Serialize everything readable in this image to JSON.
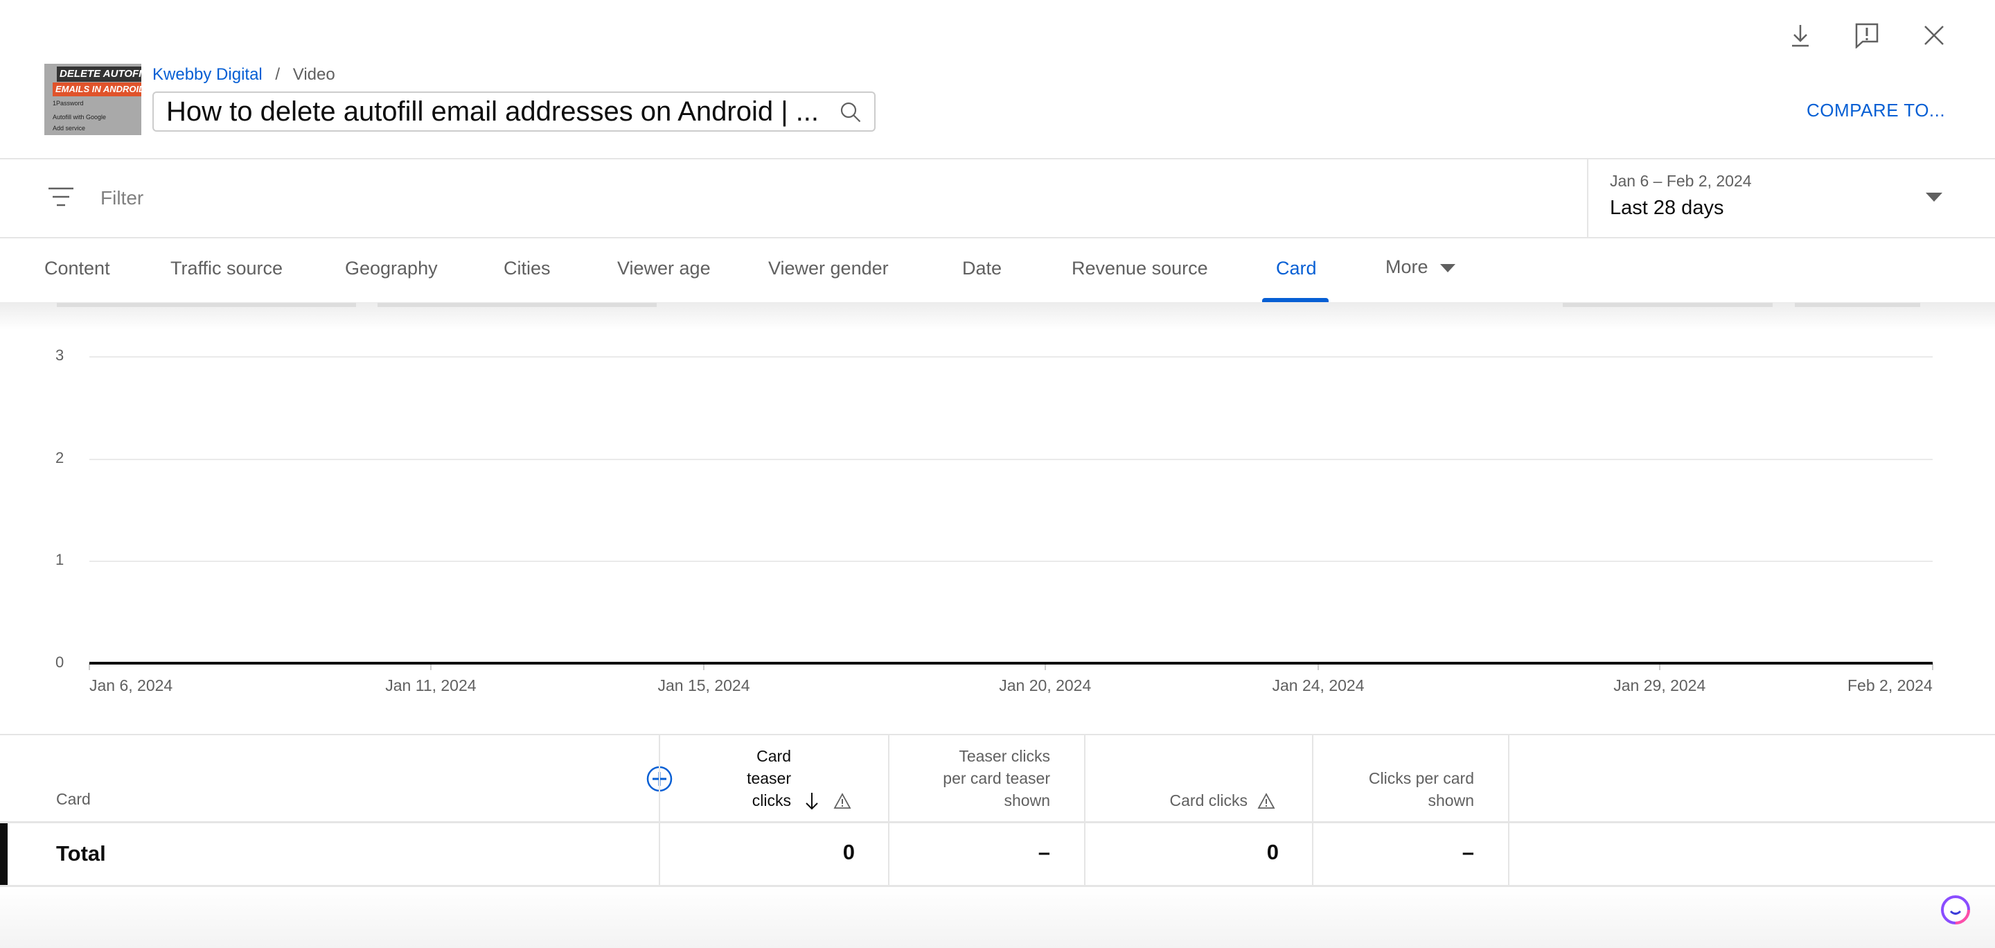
{
  "header": {
    "thumbnail": {
      "line1": "DELETE AUTOFILL",
      "line2": "EMAILS IN ANDROID",
      "items": [
        "1Password",
        "Autofill with Google",
        "Add service"
      ]
    },
    "breadcrumb": {
      "channel": "Kwebby Digital",
      "separator": "/",
      "page": "Video"
    },
    "video_title": "How to delete autofill email addresses on Android | ...",
    "compare_label": "COMPARE TO...",
    "icons": [
      "download-icon",
      "feedback-icon",
      "close-icon"
    ]
  },
  "filter": {
    "placeholder": "Filter",
    "date_range": "Jan 6 – Feb 2, 2024",
    "period": "Last 28 days"
  },
  "tabs": [
    {
      "label": "Content"
    },
    {
      "label": "Traffic source"
    },
    {
      "label": "Geography"
    },
    {
      "label": "Cities"
    },
    {
      "label": "Viewer age"
    },
    {
      "label": "Viewer gender"
    },
    {
      "label": "Date"
    },
    {
      "label": "Revenue source"
    },
    {
      "label": "Card",
      "active": true
    },
    {
      "label": "More"
    }
  ],
  "chart_data": {
    "type": "line",
    "x_ticks": [
      "Jan 6, 2024",
      "Jan 11, 2024",
      "Jan 15, 2024",
      "Jan 20, 2024",
      "Jan 24, 2024",
      "Jan 29, 2024",
      "Feb 2, 2024"
    ],
    "y_ticks": [
      "0",
      "1",
      "2",
      "3"
    ],
    "ylim": [
      0,
      3
    ],
    "xlim": [
      "2024-01-06",
      "2024-02-02"
    ],
    "grid": true,
    "series": [
      {
        "values": [
          0,
          0,
          0,
          0,
          0,
          0,
          0,
          0,
          0,
          0,
          0,
          0,
          0,
          0,
          0,
          0,
          0,
          0,
          0,
          0,
          0,
          0,
          0,
          0,
          0,
          0,
          0,
          0
        ],
        "color": "#0d0d0d"
      }
    ]
  },
  "table": {
    "dimension_header": "Card",
    "columns": [
      {
        "lines": [
          "Card",
          "teaser",
          "clicks"
        ],
        "sorted": "descending",
        "warning": true
      },
      {
        "lines": [
          "Teaser clicks",
          "per card teaser",
          "shown"
        ]
      },
      {
        "lines": [
          "Card clicks"
        ],
        "warning": true
      },
      {
        "lines": [
          "Clicks per card",
          "shown"
        ]
      }
    ],
    "total": {
      "label": "Total",
      "values": [
        "0",
        "–",
        "0",
        "–"
      ]
    }
  }
}
